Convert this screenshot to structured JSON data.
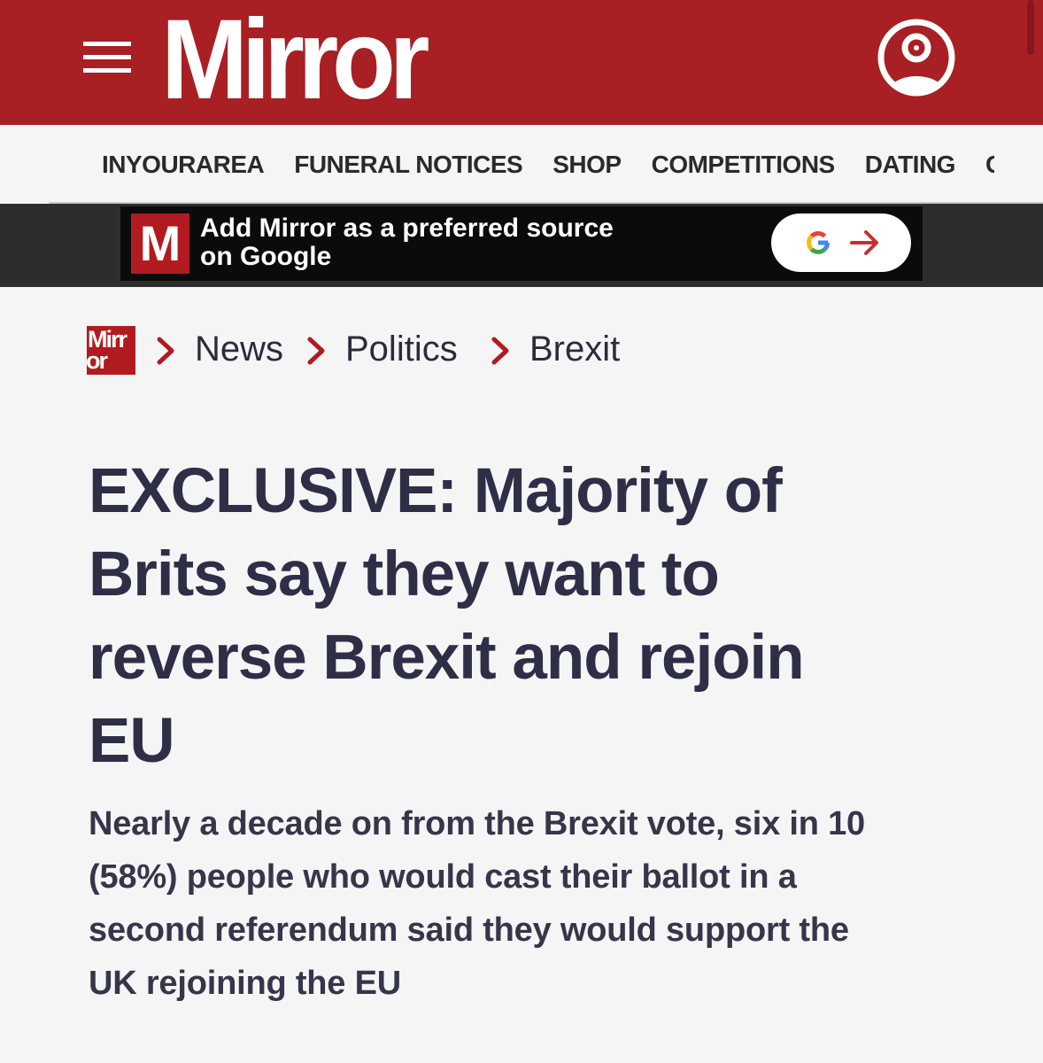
{
  "header": {
    "logo_text": "Mirror",
    "brand_color": "#a81f24",
    "menu_icon": "hamburger-menu-icon",
    "account_icon": "user-account-icon"
  },
  "subnav": {
    "items": [
      {
        "label": "INYOURAREA"
      },
      {
        "label": "FUNERAL NOTICES"
      },
      {
        "label": "SHOP"
      },
      {
        "label": "COMPETITIONS"
      },
      {
        "label": "DATING"
      },
      {
        "label": "C"
      }
    ]
  },
  "banner": {
    "logo_letter": "M",
    "text_line1": "Add Mirror as a preferred source",
    "text_line2": "on Google",
    "button_icons": [
      "google-g-icon",
      "arrow-right-icon"
    ]
  },
  "breadcrumb": {
    "logo_line1": "Mirr",
    "logo_line2": "or",
    "items": [
      {
        "label": "News"
      },
      {
        "label": "Politics"
      },
      {
        "label": "Brexit"
      }
    ]
  },
  "article": {
    "headline_lines": [
      "EXCLUSIVE: Majority of",
      "Brits say they want to",
      "reverse Brexit and rejoin",
      "EU"
    ],
    "standfirst_lines": [
      "Nearly a decade on from the Brexit vote, six in 10",
      "(58%) people who would cast their ballot in a",
      "second referendum said they would support the",
      "UK rejoining the EU"
    ]
  }
}
